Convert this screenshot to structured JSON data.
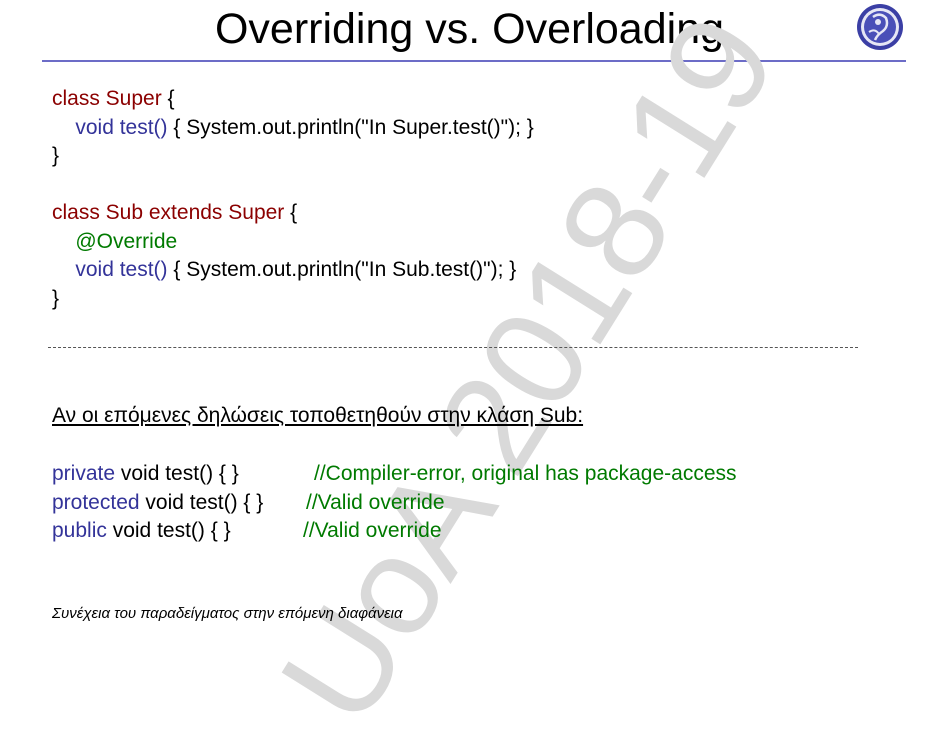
{
  "slide": {
    "title": "Overriding vs. Overloading",
    "watermark": "UoA 2018-19",
    "colors": {
      "rule": "#6c6cc7",
      "keyword_red": "#8b0000",
      "keyword_blue": "#333399",
      "comment_green": "#007a00",
      "watermark": "#d9d9d9"
    }
  },
  "code_block": {
    "super_decl": "class Super",
    "super_open": " {",
    "super_method_sig": "void test()",
    "super_method_body": " { System.out.println(\"In Super.test()\"); }",
    "super_close": "}",
    "sub_decl": "class Sub extends Super",
    "sub_open": " {",
    "annotation": "@Override",
    "sub_method_sig": "void test()",
    "sub_method_body": " { System.out.println(\"In Sub.test()\"); }",
    "sub_close": "}"
  },
  "heading": "Αν οι επόμενες δηλώσεις τοποθετηθούν στην κλάση Sub:",
  "declarations": [
    {
      "modifier": "private",
      "rest": " void test() { }",
      "comment": "//Compiler-error, original has package-access"
    },
    {
      "modifier": "protected",
      "rest": " void test() { }",
      "comment": "//Valid override"
    },
    {
      "modifier": "public",
      "rest": " void test() { }",
      "comment": "//Valid override"
    }
  ],
  "footer": "Συνέχεια του παραδείγματος στην επόμενη διαφάνεια"
}
